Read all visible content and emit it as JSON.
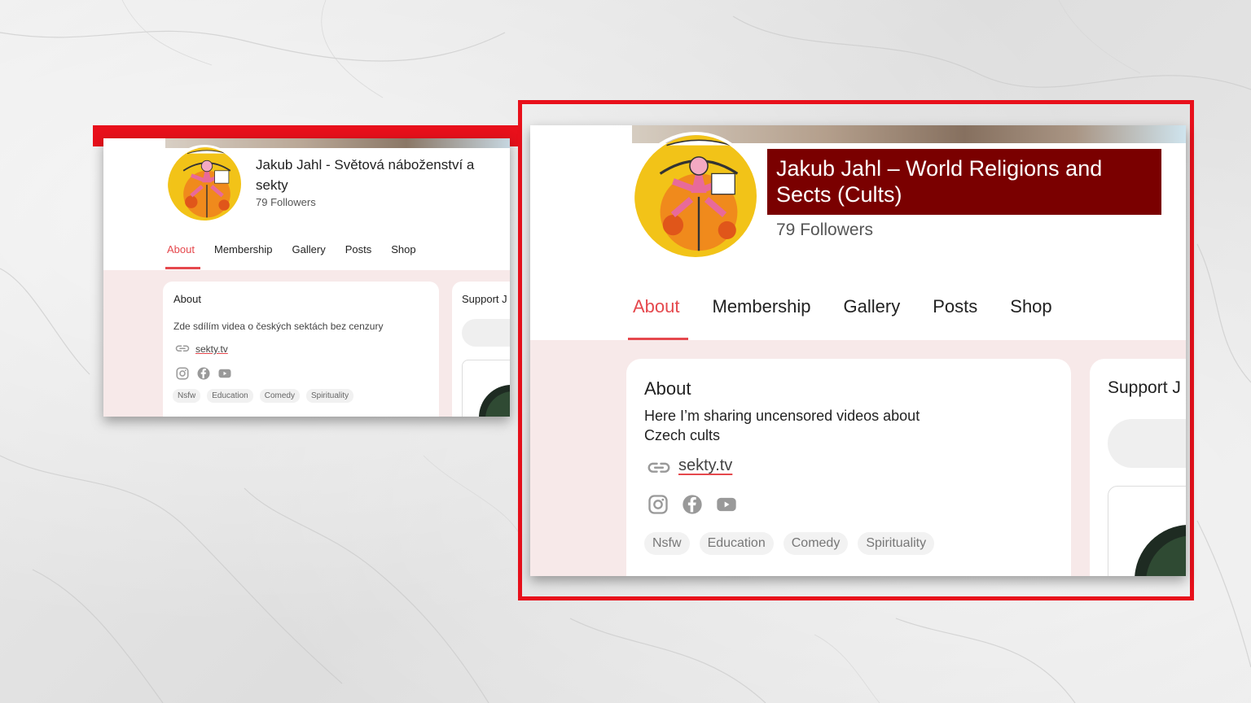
{
  "original": {
    "title": "Jakub Jahl - Světová náboženství a sekty",
    "followers": "79 Followers",
    "tabs": [
      "About",
      "Membership",
      "Gallery",
      "Posts",
      "Shop"
    ],
    "about_heading": "About",
    "about_text": "Zde sdílím videa o českých sektách bez cenzury",
    "link": "sekty.tv",
    "tags": [
      "Nsfw",
      "Education",
      "Comedy",
      "Spirituality"
    ],
    "support_heading": "Support J"
  },
  "translated": {
    "title": "Jakub Jahl – World Religions and Sects (Cults)",
    "followers": "79 Followers",
    "tabs": [
      "About",
      "Membership",
      "Gallery",
      "Posts",
      "Shop"
    ],
    "about_heading": "About",
    "about_text": "Here I’m sharing uncensored videos about Czech cults",
    "link": "sekty.tv",
    "tags": [
      "Nsfw",
      "Education",
      "Comedy",
      "Spirituality"
    ],
    "support_heading": "Support J"
  },
  "icons": {
    "link": "link-icon",
    "instagram": "instagram-icon",
    "facebook": "facebook-icon",
    "youtube": "youtube-icon"
  },
  "colors": {
    "highlight_red": "#e8101b",
    "title_box": "#7a0000",
    "accent": "#e5484d",
    "body_tint": "#f7e9e9"
  }
}
